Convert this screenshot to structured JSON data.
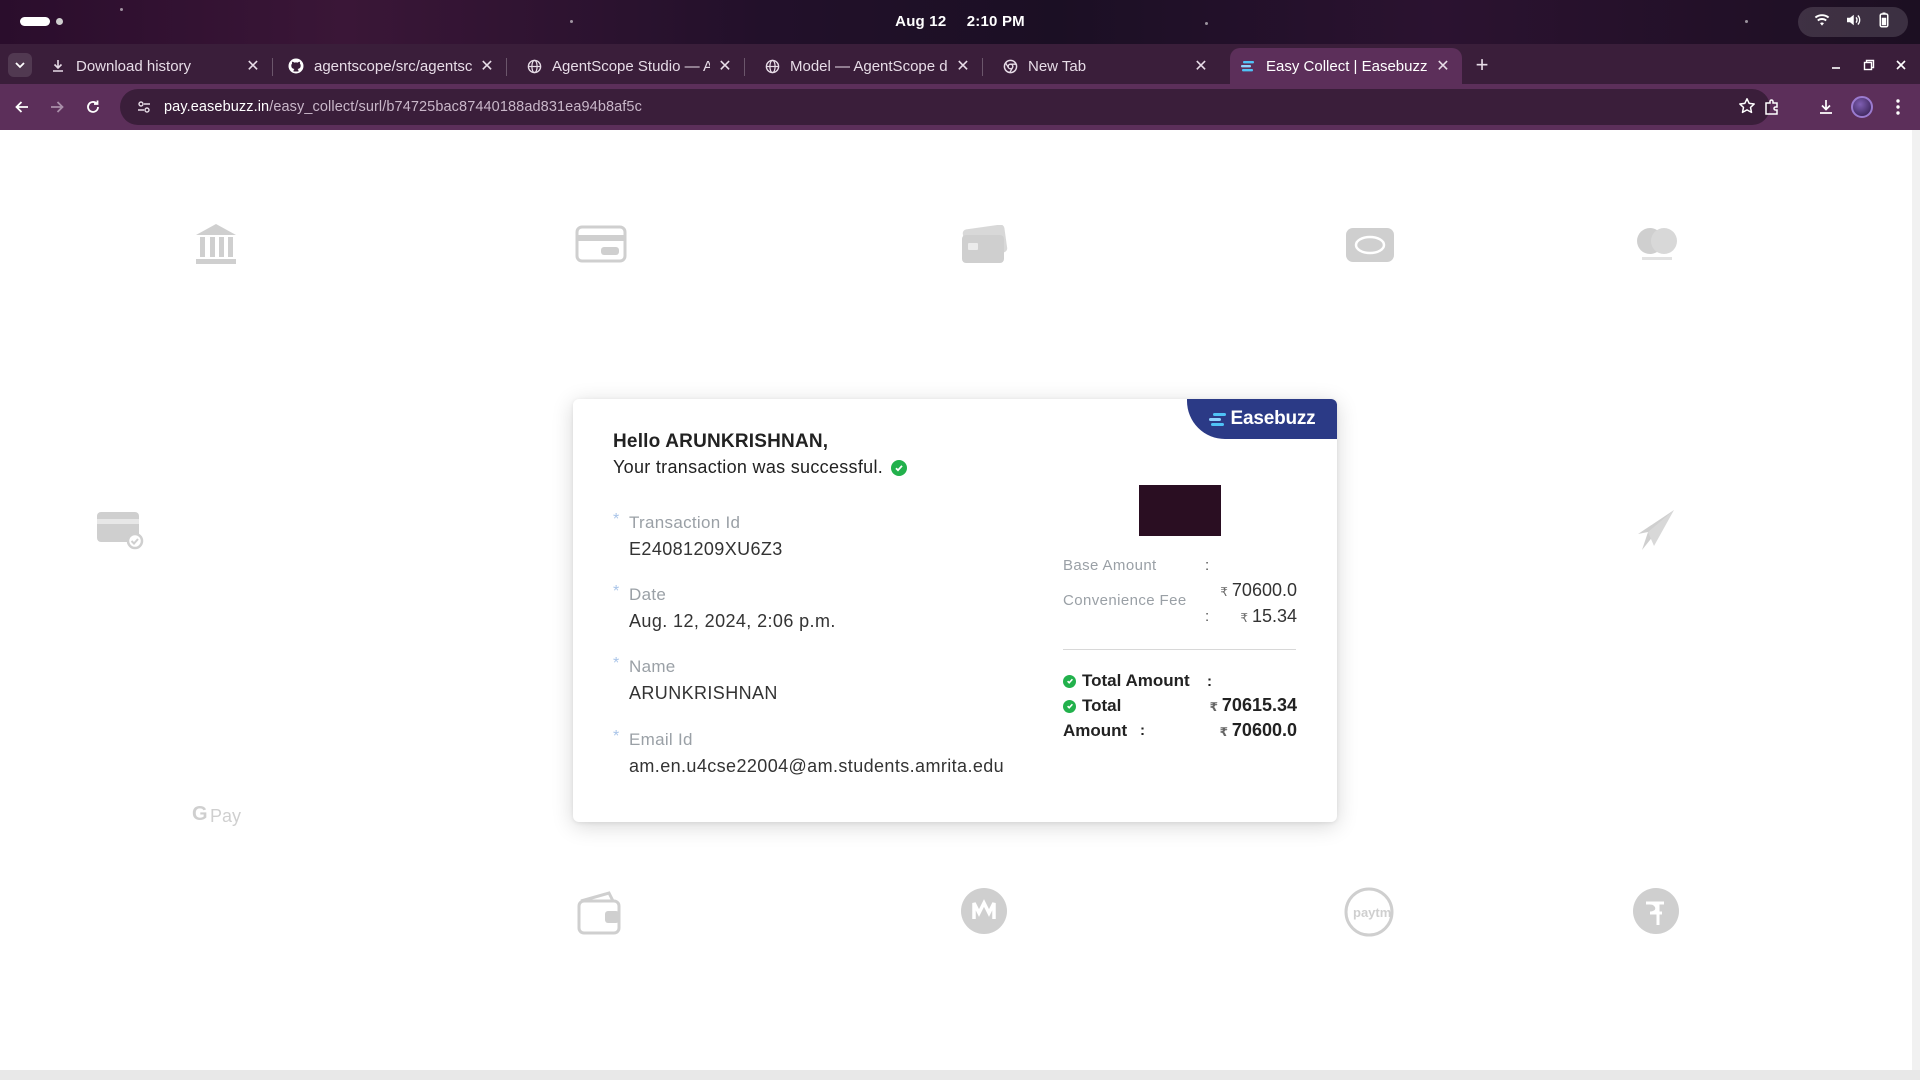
{
  "os": {
    "date": "Aug 12",
    "time": "2:10 PM"
  },
  "browser": {
    "tabs": [
      {
        "title": "Download history",
        "icon": "download-icon",
        "active": false
      },
      {
        "title": "agentscope/src/agentsco",
        "icon": "github-icon",
        "active": false
      },
      {
        "title": "AgentScope Studio — Ag",
        "icon": "globe-icon",
        "active": false
      },
      {
        "title": "Model — AgentScope do",
        "icon": "globe-icon",
        "active": false
      },
      {
        "title": "New Tab",
        "icon": "chrome-icon",
        "active": false
      },
      {
        "title": "Easy Collect | Easebuzz",
        "icon": "easebuzz-icon",
        "active": true
      }
    ],
    "url_host": "pay.easebuzz.in",
    "url_path": "/easy_collect/surl/b74725bac87440188ad831ea94b8af5c"
  },
  "card": {
    "brand": "Easebuzz",
    "greeting": "Hello ARUNKRISHNAN,",
    "status": "Your transaction was successful.",
    "fields": {
      "txn_label": "Transaction Id",
      "txn_value": "E24081209XU6Z3",
      "date_label": "Date",
      "date_value": "Aug. 12, 2024, 2:06 p.m.",
      "name_label": "Name",
      "name_value": "ARUNKRISHNAN",
      "email_label": "Email Id",
      "email_value": "am.en.u4cse22004@am.students.amrita.edu"
    },
    "amounts": {
      "currency_symbol": "₹",
      "colon": ":",
      "base_label": "Base Amount",
      "base_value": "70600.0",
      "fee_label": "Convenience Fee",
      "fee_value": "15.34",
      "total_label": "Total Amount",
      "total_value": "70615.34",
      "total2_label_a": "Total",
      "total2_label_b": "Amount",
      "total2_value": "70600.0"
    }
  },
  "colors": {
    "brand_blue": "#2b3a86",
    "success_green": "#22b14c",
    "browser_chrome": "#5c2f5a"
  }
}
